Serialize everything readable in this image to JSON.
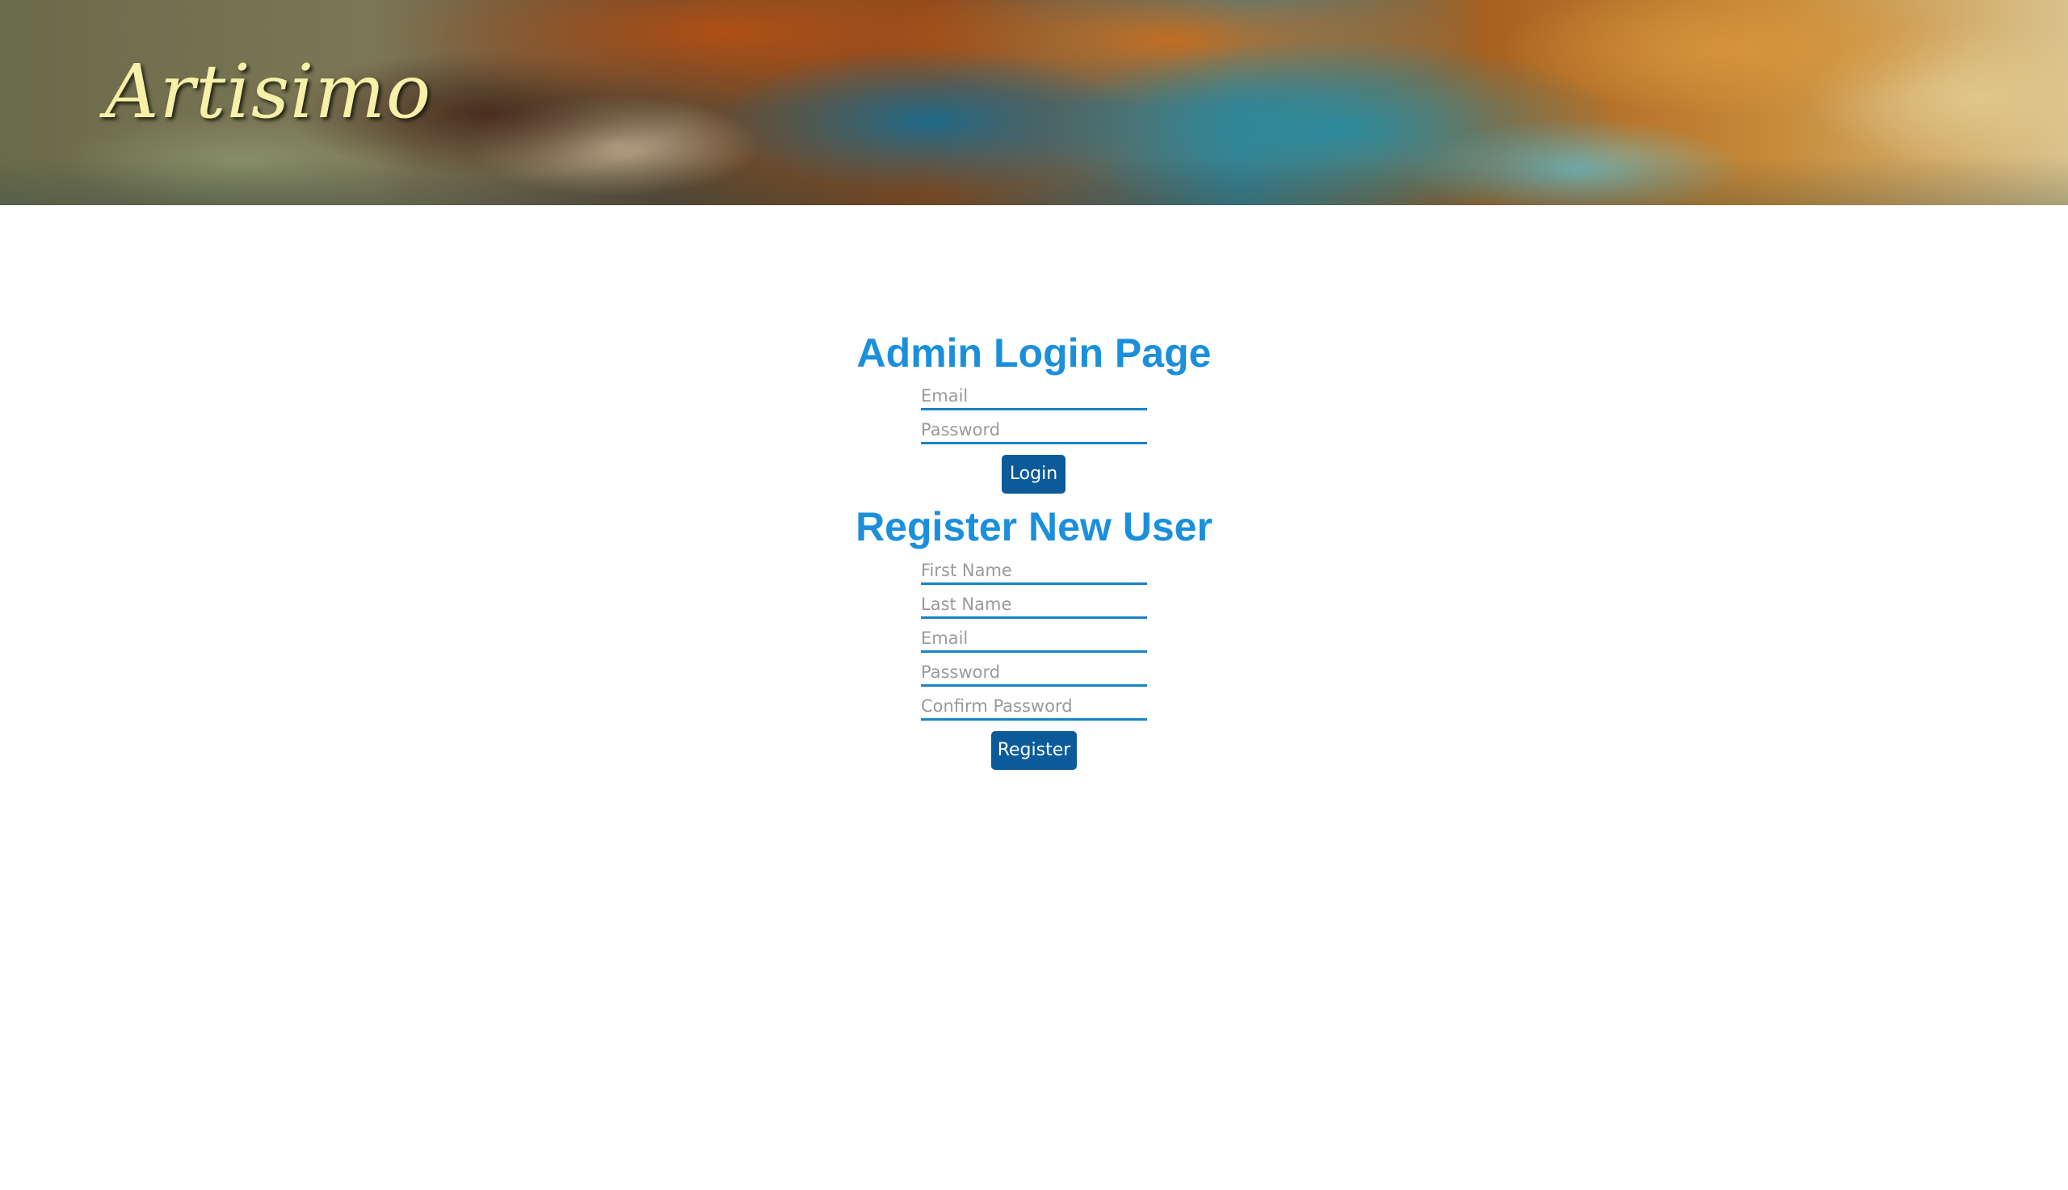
{
  "header": {
    "brand": "Artisimo"
  },
  "login": {
    "title": "Admin Login Page",
    "email_placeholder": "Email",
    "password_placeholder": "Password",
    "button_label": "Login"
  },
  "register": {
    "title": "Register New User",
    "first_name_placeholder": "First Name",
    "last_name_placeholder": "Last Name",
    "email_placeholder": "Email",
    "password_placeholder": "Password",
    "confirm_password_placeholder": "Confirm Password",
    "button_label": "Register"
  },
  "colors": {
    "heading": "#1b8fdb",
    "button": "#0b5a99",
    "field_underline": "#1a82c8",
    "brand_text": "#f6f0a8"
  }
}
